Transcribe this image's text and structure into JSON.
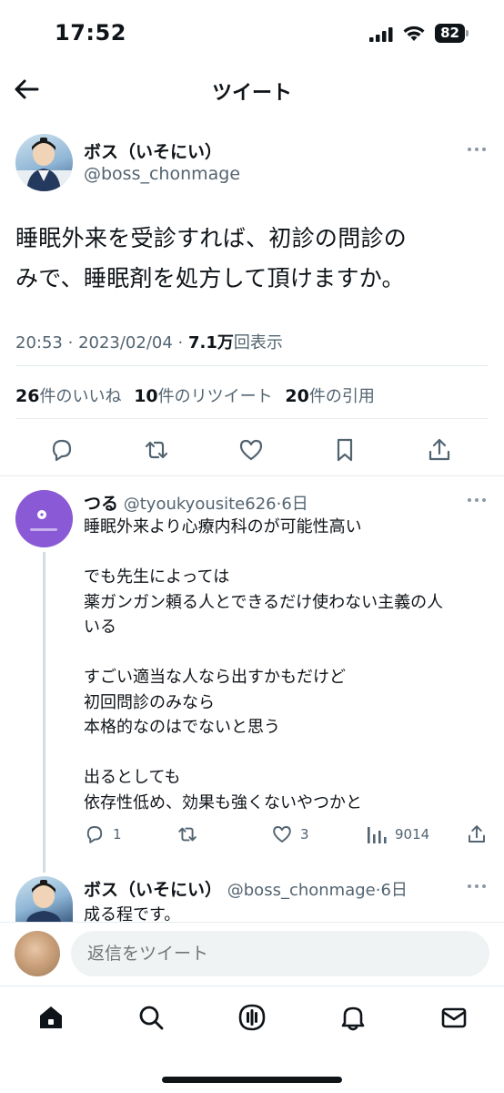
{
  "status_bar": {
    "time": "17:52",
    "battery": "82"
  },
  "header": {
    "title": "ツイート"
  },
  "tweet": {
    "author_name": "ボス（いそにい）",
    "author_handle": "@boss_chonmage",
    "text_line1": "睡眠外来を受診すれば、初診の問診の",
    "text_line2": "みで、睡眠剤を処方して頂けますか。",
    "time": "20:53",
    "date": "2023/02/04",
    "views_count": "7.1万",
    "views_label": "回表示",
    "likes_count": "26",
    "likes_label": "件のいいね",
    "retweets_count": "10",
    "retweets_label": "件のリツイート",
    "quotes_count": "20",
    "quotes_label": "件の引用"
  },
  "replies": [
    {
      "name": "つる",
      "handle": "@tyoukyousite626",
      "time": "6日",
      "text": "睡眠外来より心療内科のが可能性高い\n\nでも先生によっては\n薬ガンガン頼る人とできるだけ使わない主義の人\nいる\n\nすごい適当な人なら出すかもだけど\n初回問診のみなら\n本格的なのはでないと思う\n\n出るとしても\n依存性低め、効果も強くないやつかと",
      "reply_count": "1",
      "retweet_count": "",
      "like_count": "3",
      "view_count": "9014"
    },
    {
      "name": "ボス（いそにい）",
      "handle": "@boss_chonmage",
      "time": "6日",
      "text": "成る程です。"
    }
  ],
  "compose": {
    "placeholder": "返信をツイート"
  },
  "colors": {
    "text": "#0f1419",
    "secondary": "#536471",
    "divider": "#e6ecf0"
  }
}
